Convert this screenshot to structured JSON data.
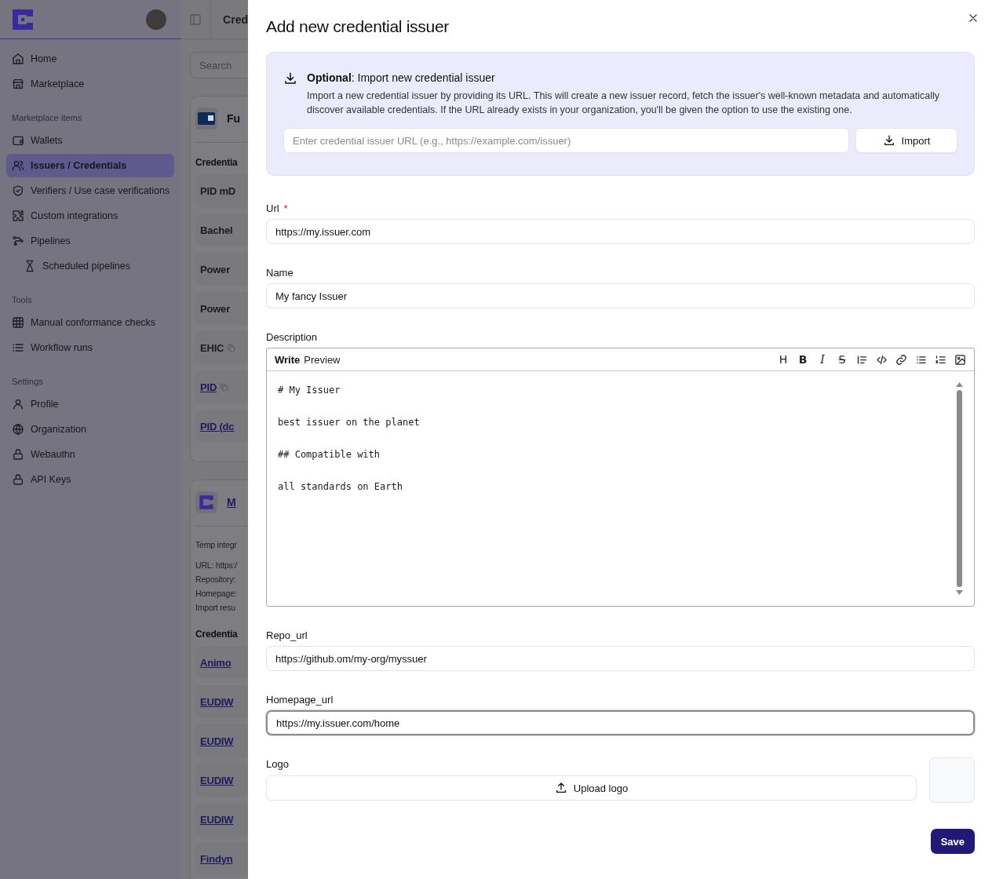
{
  "sidebar": {
    "sections": [
      {
        "items": [
          {
            "label": "Home",
            "selected": false
          },
          {
            "label": "Marketplace",
            "selected": false
          }
        ]
      },
      {
        "title": "Marketplace items",
        "items": [
          {
            "label": "Wallets",
            "selected": false
          },
          {
            "label": "Issuers / Credentials",
            "selected": true
          },
          {
            "label": "Verifiers / Use case verifications",
            "selected": false
          },
          {
            "label": "Custom integrations",
            "selected": false
          },
          {
            "label": "Pipelines",
            "selected": false,
            "children": [
              {
                "label": "Scheduled pipelines",
                "selected": false
              }
            ]
          }
        ]
      },
      {
        "title": "Tools",
        "items": [
          {
            "label": "Manual conformance checks",
            "selected": false
          },
          {
            "label": "Workflow runs",
            "selected": false
          }
        ]
      },
      {
        "title": "Settings",
        "items": [
          {
            "label": "Profile",
            "selected": false
          },
          {
            "label": "Organization",
            "selected": false
          },
          {
            "label": "Webauthn",
            "selected": false
          },
          {
            "label": "API Keys",
            "selected": false
          }
        ]
      }
    ]
  },
  "background": {
    "header_title": "Cred",
    "search": {
      "placeholder": "Search"
    },
    "cards": [
      {
        "title": "Fu",
        "title_link": false,
        "section": "Credentia",
        "credentials": [
          {
            "label": "PID mD",
            "link": false,
            "copy": false
          },
          {
            "label": "Bachel",
            "link": false,
            "copy": false
          },
          {
            "label": "Power",
            "link": false,
            "copy": false
          },
          {
            "label": "Power",
            "link": false,
            "copy": false
          },
          {
            "label": "EHIC",
            "link": false,
            "copy": true
          },
          {
            "label": "PID",
            "link": true,
            "copy": true
          },
          {
            "label": "PID (dc",
            "link": true,
            "copy": false
          }
        ]
      },
      {
        "title": "M",
        "title_link": true,
        "details": [
          "Temp integr",
          "URL: https:/",
          "Repository:",
          "Homepage:",
          "Import resu"
        ],
        "section": "Credentia",
        "credentials": [
          {
            "label": "Animo",
            "link": true,
            "copy": false
          },
          {
            "label": "EUDIW",
            "link": true,
            "copy": false
          },
          {
            "label": "EUDIW",
            "link": true,
            "copy": false
          },
          {
            "label": "EUDIW",
            "link": true,
            "copy": false
          },
          {
            "label": "EUDIW",
            "link": true,
            "copy": false
          },
          {
            "label": "Findyn",
            "link": true,
            "copy": false
          }
        ]
      }
    ]
  },
  "dialog": {
    "title": "Add new credential issuer",
    "import": {
      "heading": "**Optional**: Import new credential issuer",
      "text": "Import a new credential issuer by providing its URL. This will create a new issuer record, fetch the issuer's well-known metadata and automatically discover available credentials. If the URL already exists in your organization, you'll be given the option to use the existing one.",
      "placeholder": "Enter credential issuer URL (e.g., https://example.com/issuer)",
      "button": "Import"
    },
    "fields": [
      {
        "kind": "text",
        "label": "Url",
        "required_mark": "*",
        "value": "https://my.issuer.com",
        "focused": false
      },
      {
        "kind": "text",
        "label": "Name",
        "value": "My fancy Issuer",
        "focused": false
      },
      {
        "kind": "markdown",
        "label": "Description",
        "tabs": [
          {
            "label": "Write",
            "selected": true
          },
          {
            "label": "Preview",
            "selected": false
          }
        ],
        "toolbar": [
          {
            "kind": "text",
            "label": "H"
          },
          {
            "kind": "bold",
            "label": "B"
          },
          {
            "kind": "italic",
            "label": "I"
          },
          {
            "kind": "strike",
            "label": "S"
          },
          {
            "kind": "quote"
          },
          {
            "kind": "code"
          },
          {
            "kind": "link"
          },
          {
            "kind": "bullets"
          },
          {
            "kind": "numbers"
          },
          {
            "kind": "image"
          }
        ],
        "value": "# My Issuer\n\nbest issuer on the planet\n\n## Compatible with\n\nall standards on Earth"
      },
      {
        "kind": "text",
        "label": "Repo_url",
        "value": "https://github.om/my-org/myssuer",
        "focused": false
      },
      {
        "kind": "text",
        "label": "Homepage_url",
        "value": "https://my.issuer.com/home",
        "focused": true
      },
      {
        "kind": "upload",
        "label": "Logo",
        "button": "Upload logo"
      }
    ],
    "save": "Save"
  }
}
